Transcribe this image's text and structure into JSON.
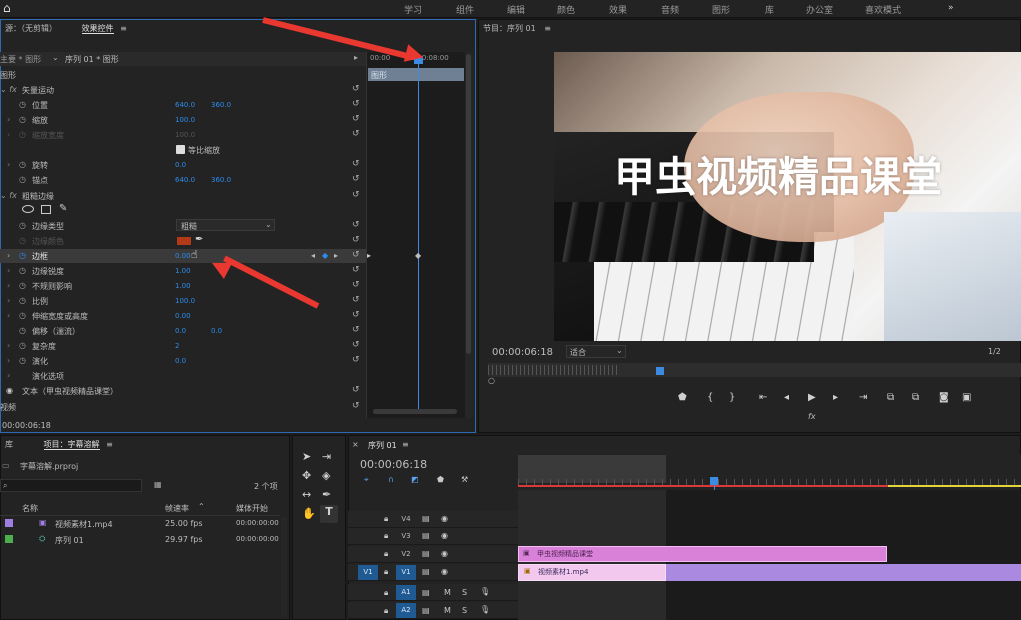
{
  "workspaces": [
    "学习",
    "组件",
    "编辑",
    "颜色",
    "效果",
    "音频",
    "图形",
    "库",
    "办公室",
    "喜欢模式",
    "»"
  ],
  "effect_controls": {
    "source_tab": "源：（无剪辑）",
    "tab": "效果控件",
    "menu": "≡",
    "master_label": "主要 * 图形",
    "sequence_label": "序列 01 * 图形",
    "section_graphic": "图形",
    "footer_time": "00:00:06:18",
    "section_video": "视频",
    "rows": [
      {
        "label": "矢量运动"
      },
      {
        "label": "位置",
        "v1": "640.0",
        "v2": "360.0"
      },
      {
        "label": "缩放",
        "v1": "100.0"
      },
      {
        "label": "缩放宽度",
        "v1": "100.0"
      },
      {
        "label": "等比缩放"
      },
      {
        "label": "旋转",
        "v1": "0.0"
      },
      {
        "label": "锚点",
        "v1": "640.0",
        "v2": "360.0"
      },
      {
        "label": "粗糙边缘"
      },
      {
        "label": "边缘类型",
        "v1": "粗糙"
      },
      {
        "label": "边缘颜色"
      },
      {
        "label": "边框",
        "v1": "0.00"
      },
      {
        "label": "边缘锐度",
        "v1": "1.00"
      },
      {
        "label": "不规则影响",
        "v1": "1.00"
      },
      {
        "label": "比例",
        "v1": "100.0"
      },
      {
        "label": "伸缩宽度或高度",
        "v1": "0.00"
      },
      {
        "label": "偏移（湍流）",
        "v1": "0.0",
        "v2": "0.0"
      },
      {
        "label": "复杂度",
        "v1": "2"
      },
      {
        "label": "演化",
        "v1": "0.0"
      },
      {
        "label": "演化选项"
      },
      {
        "label": "文本（甲虫视频精品课堂）"
      }
    ],
    "timeline": {
      "t1": "00:00",
      "t2": "00:00:08:00",
      "clip": "图形"
    }
  },
  "program": {
    "title": "节目：序列 01",
    "menu": "≡",
    "overlay_text": "甲虫视频精品课堂",
    "timecode": "00:00:06:18",
    "fit": "适合",
    "ratio": "1/2"
  },
  "project": {
    "tab_lib": "库",
    "tab": "项目：字幕溶解",
    "menu": "≡",
    "file": "字幕溶解.prproj",
    "count": "2 个项",
    "col_name": "名称",
    "col_fps": "帧速率",
    "col_media": "媒体开始",
    "items": [
      {
        "name": "视频素材1.mp4",
        "fps": "25.00 fps",
        "start": "00:00:00:00",
        "color": "#a07de0"
      },
      {
        "name": "序列 01",
        "fps": "29.97 fps",
        "start": "00:00:00:00",
        "color": "#4cae4c"
      }
    ]
  },
  "sequence": {
    "title": "序列 01",
    "menu": "≡",
    "timecode": "00:00:06:18",
    "tracks": [
      "V4",
      "V3",
      "V2",
      "V1",
      "A1",
      "A2"
    ],
    "source_v1": "V1",
    "source_a1": "A1",
    "clip_graphic": "甲虫视频精品课堂",
    "clip_video": "视频素材1.mp4"
  }
}
